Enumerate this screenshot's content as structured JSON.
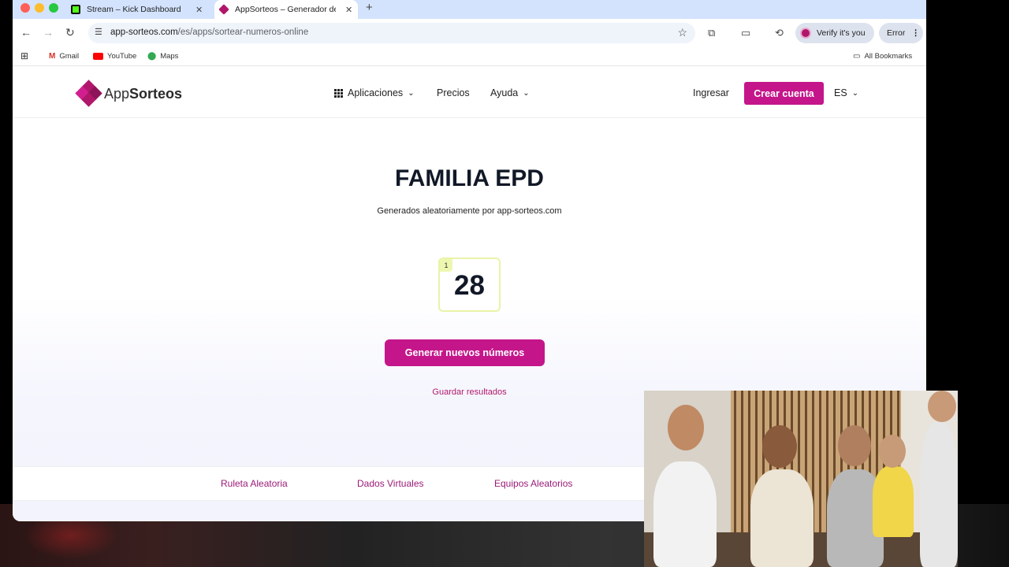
{
  "browser": {
    "tabs": [
      {
        "title": "Stream – Kick Dashboard",
        "active": false,
        "favicon": "kick-icon"
      },
      {
        "title": "AppSorteos – Generador de N",
        "active": true,
        "favicon": "appsorteos-icon"
      }
    ],
    "url_host": "app-sorteos.com",
    "url_path": "/es/apps/sortear-numeros-online",
    "verify_label": "Verify it's you",
    "error_label": "Error",
    "bookmarks": [
      {
        "label": "Gmail",
        "icon": "gmail-icon"
      },
      {
        "label": "YouTube",
        "icon": "youtube-icon"
      },
      {
        "label": "Maps",
        "icon": "maps-icon"
      }
    ],
    "all_bookmarks": "All Bookmarks"
  },
  "site": {
    "logo_prefix": "App",
    "logo_bold": "Sorteos",
    "nav": {
      "aplicaciones": "Aplicaciones",
      "precios": "Precios",
      "ayuda": "Ayuda",
      "ingresar": "Ingresar",
      "crear_cuenta": "Crear cuenta",
      "lang": "ES"
    },
    "accent_color": "#c4168a"
  },
  "main": {
    "title": "FAMILIA EPD",
    "subtitle": "Generados aleatoriamente por app-sorteos.com",
    "result_index": "1",
    "result_number": "28",
    "generate_button": "Generar nuevos números",
    "save_link": "Guardar resultados"
  },
  "footer_links": [
    "Ruleta Aleatoria",
    "Dados Virtuales",
    "Equipos Aleatorios"
  ]
}
